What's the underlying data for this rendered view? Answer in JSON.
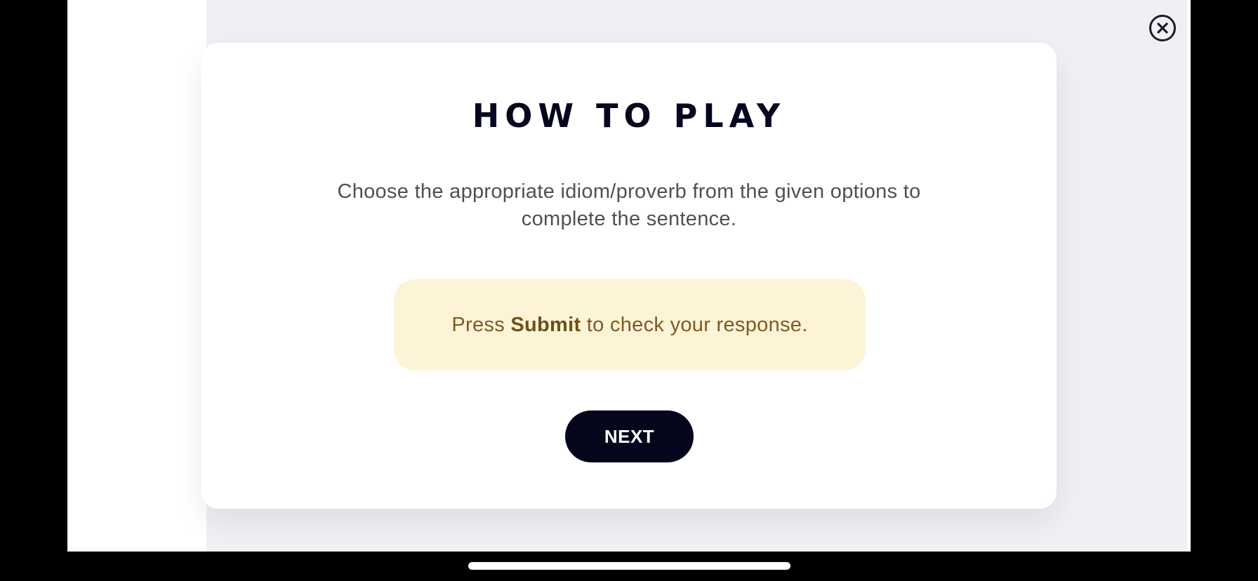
{
  "dialog": {
    "title": "HOW TO PLAY",
    "instructions": "Choose the appropriate idiom/proverb from the given options to complete the sentence.",
    "tip": {
      "prefix": "Press ",
      "emphasis": "Submit",
      "suffix": " to check your response."
    },
    "next_label": "NEXT",
    "close_icon": "close-circle-icon"
  },
  "colors": {
    "backdrop": "#efeff4",
    "card": "#ffffff",
    "title": "#06061e",
    "tip_background": "#fdf3d6",
    "tip_text": "#7a5c24",
    "button": "#05051c"
  }
}
